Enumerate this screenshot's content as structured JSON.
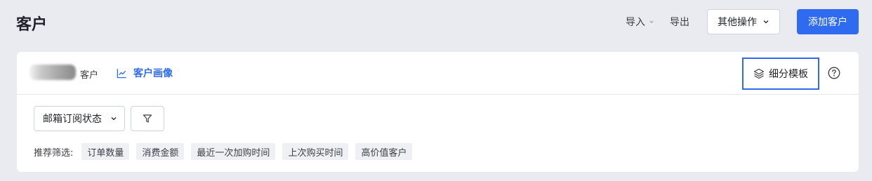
{
  "page": {
    "title": "客户"
  },
  "header": {
    "import_label": "导入",
    "export_label": "导出",
    "more_actions_label": "其他操作",
    "add_customer_label": "添加客户"
  },
  "card": {
    "count_suffix": "客户",
    "profile_link_label": "客户画像",
    "template_button_label": "细分模板"
  },
  "filters": {
    "subscription_select_value": "邮箱订阅状态"
  },
  "recommended": {
    "label": "推荐筛选:",
    "chips": [
      "订单数量",
      "消费金额",
      "最近一次加购时间",
      "上次购买时间",
      "高价值客户"
    ]
  },
  "colors": {
    "accent": "#2f6bf0",
    "background": "#e9ebf0",
    "card": "#ffffff",
    "chip": "#eef0f4"
  }
}
